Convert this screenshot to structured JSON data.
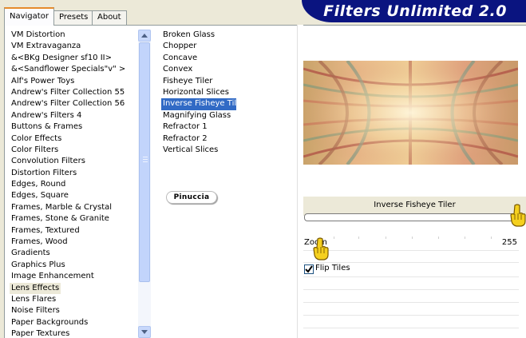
{
  "tabs": [
    {
      "label": "Navigator",
      "active": true
    },
    {
      "label": "Presets",
      "active": false
    },
    {
      "label": "About",
      "active": false
    }
  ],
  "banner": {
    "title": "Filters Unlimited 2.0",
    "color": "#0a1480"
  },
  "categories": [
    "VM Distortion",
    "VM Extravaganza",
    "&<BKg Designer sf10 II>",
    "&<Sandflower Specials\"v\" >",
    "Alf's Power Toys",
    "Andrew's Filter Collection 55",
    "Andrew's Filter Collection 56",
    "Andrew's Filters 4",
    "Buttons & Frames",
    "Color Effects",
    "Color Filters",
    "Convolution Filters",
    "Distortion Filters",
    "Edges, Round",
    "Edges, Square",
    "Frames, Marble & Crystal",
    "Frames, Stone & Granite",
    "Frames, Textured",
    "Frames, Wood",
    "Gradients",
    "Graphics Plus",
    "Image Enhancement",
    "Lens Effects",
    "Lens Flares",
    "Noise Filters",
    "Paper Backgrounds",
    "Paper Textures"
  ],
  "selected_category": "Lens Effects",
  "filters": [
    "Broken Glass",
    "Chopper",
    "Concave",
    "Convex",
    "Fisheye Tiler",
    "Horizontal Slices",
    "Inverse Fisheye Tiler",
    "Magnifying Glass",
    "Refractor 1",
    "Refractor 2",
    "Vertical Slices"
  ],
  "selected_filter": "Inverse Fisheye Tiler",
  "logo": {
    "text": "Pinuccia"
  },
  "settings": {
    "filter_name": "Inverse Fisheye Tiler",
    "zoom": {
      "label": "Zoom",
      "value": "255"
    },
    "flip_tiles": {
      "label": "Flip Tiles",
      "checked": true
    }
  },
  "icons": {
    "scroll_up": "arrow-up-icon",
    "scroll_down": "arrow-down-icon",
    "pointer": "pointing-hand-icon"
  }
}
